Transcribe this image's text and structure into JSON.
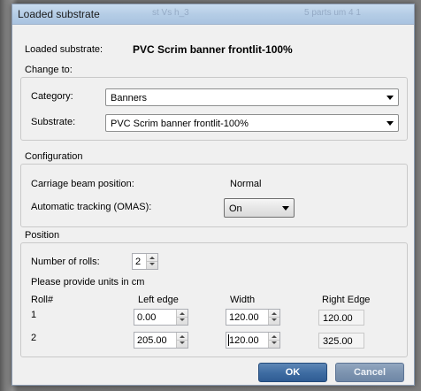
{
  "window": {
    "title": "Loaded substrate",
    "ghost_title_left": "st Vs h_3",
    "ghost_title_right": "5 parts um 4 1"
  },
  "loaded": {
    "label": "Loaded substrate:",
    "value": "PVC Scrim banner frontlit-100%"
  },
  "change_to": {
    "group_label": "Change to:",
    "category_label": "Category:",
    "category_value": "Banners",
    "substrate_label": "Substrate:",
    "substrate_value": "PVC Scrim banner frontlit-100%"
  },
  "configuration": {
    "group_label": "Configuration",
    "carriage_label": "Carriage beam position:",
    "carriage_value": "Normal",
    "tracking_label": "Automatic tracking (OMAS):",
    "tracking_value": "On"
  },
  "position": {
    "group_label": "Position",
    "rolls_label": "Number of rolls:",
    "rolls_value": "2",
    "units_note": "Please provide units in cm",
    "columns": {
      "roll": "Roll#",
      "left": "Left edge",
      "width": "Width",
      "right": "Right Edge"
    },
    "rows": [
      {
        "roll": "1",
        "left": "0.00",
        "width": "120.00",
        "right": "120.00"
      },
      {
        "roll": "2",
        "left": "205.00",
        "width": "120.00",
        "right": "325.00"
      }
    ]
  },
  "buttons": {
    "ok": "OK",
    "cancel": "Cancel"
  }
}
